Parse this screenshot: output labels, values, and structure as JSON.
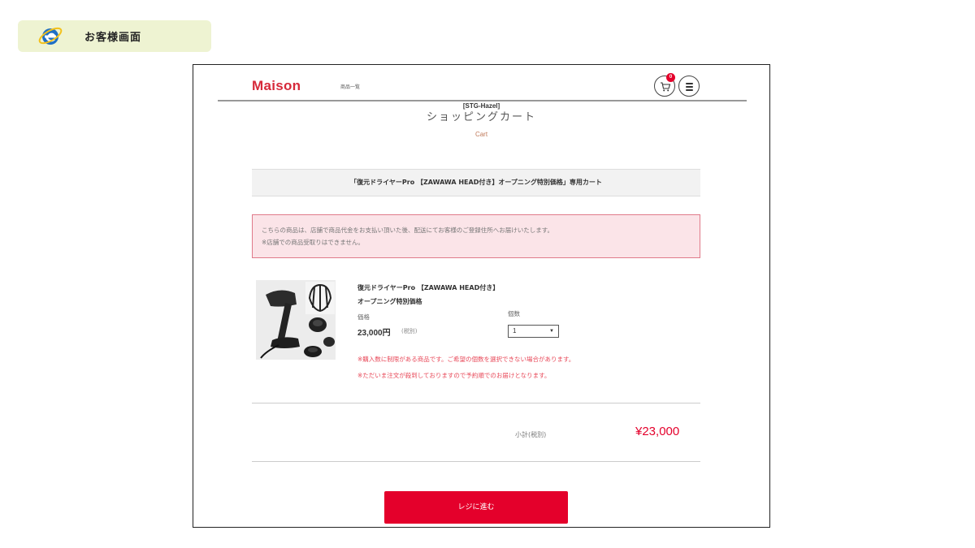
{
  "screen_label": {
    "text": "お客様画面",
    "icon": "internet-explorer-icon"
  },
  "site": {
    "logo": "Maison",
    "nav_products": "商品一覧",
    "cart_count": "0",
    "store_code": "[STG-Hazel]",
    "page_title": "ショッピングカート",
    "page_subtitle": "Cart"
  },
  "cart": {
    "header": "「復元ドライヤーPro 【ZAWAWA HEAD付き】オープニング特別価格」専用カート",
    "notice_line1": "こちらの商品は、店舗で商品代金をお支払い頂いた後、配送にてお客様のご登録住所へお届けいたします。",
    "notice_line2": "※店舗での商品受取りはできません。"
  },
  "product": {
    "name_line1": "復元ドライヤーPro 【ZAWAWA HEAD付き】",
    "name_line2": "オープニング特別価格",
    "price_label": "価格",
    "price_value": "23,000円",
    "price_tax": "(税別)",
    "qty_label": "個数",
    "qty_value": "1",
    "note1": "※購入数に制限がある商品です。ご希望の個数を選択できない場合があります。",
    "note2": "※ただいま注文が殺到しておりますので予約順でのお届けとなります。"
  },
  "summary": {
    "subtotal_label": "小計(税別)",
    "subtotal_value": "¥23,000"
  },
  "checkout": {
    "label": "レジに進む"
  },
  "colors": {
    "accent": "#e4002b",
    "logo": "#d6293a",
    "label_bg": "#eef3d2"
  }
}
